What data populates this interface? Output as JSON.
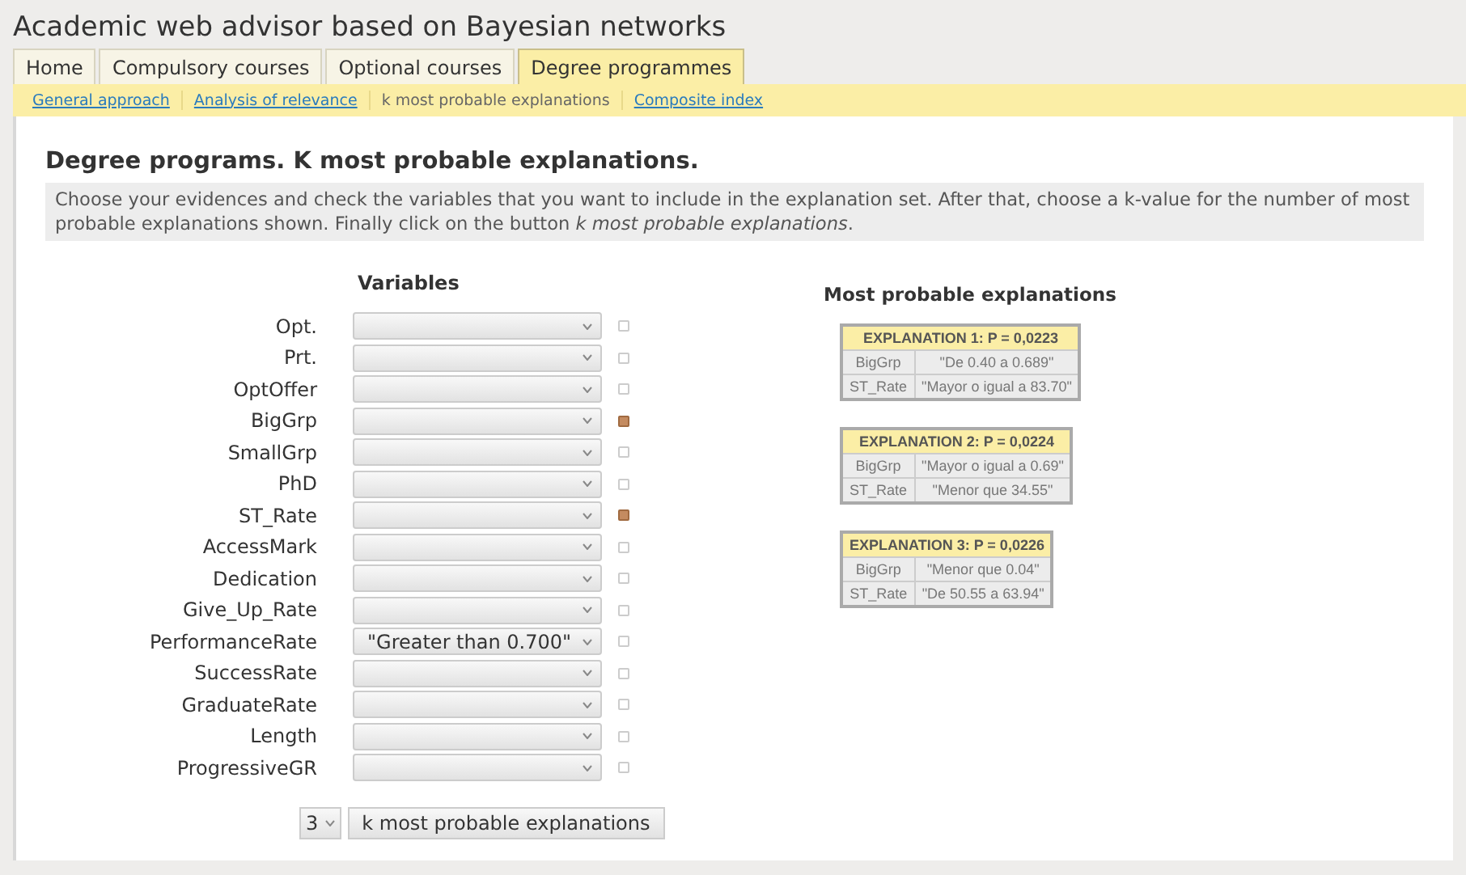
{
  "app_title": "Academic web advisor based on Bayesian networks",
  "tabs": [
    {
      "label": "Home",
      "selected": false
    },
    {
      "label": "Compulsory courses",
      "selected": false
    },
    {
      "label": "Optional courses",
      "selected": false
    },
    {
      "label": "Degree programmes",
      "selected": true
    }
  ],
  "subnav": [
    {
      "label": "General approach",
      "selected": false
    },
    {
      "label": "Analysis of relevance",
      "selected": false
    },
    {
      "label": "k most probable explanations",
      "selected": true
    },
    {
      "label": "Composite index",
      "selected": false
    }
  ],
  "heading": "Degree programs. K most probable explanations.",
  "description": "Choose your evidences and check the variables that you want to include in the explanation set. After that, choose a k-value for the number of most probable explanations shown. Finally click on the button *k most probable explanations*.",
  "variables_header": "Variables",
  "variables": [
    {
      "name": "Opt.",
      "checked": false
    },
    {
      "name": "Prt.",
      "checked": false
    },
    {
      "name": "OptOffer",
      "checked": false
    },
    {
      "name": "BigGrp",
      "checked": true
    },
    {
      "name": "SmallGrp",
      "checked": false
    },
    {
      "name": "PhD",
      "checked": false
    },
    {
      "name": "ST_Rate",
      "checked": true
    },
    {
      "name": "AccessMark",
      "checked": false
    },
    {
      "name": "Dedication",
      "checked": false
    },
    {
      "name": "Give_Up_Rate",
      "checked": false
    },
    {
      "name": "PerformanceRate",
      "value": "\"Greater than 0.700\"",
      "checked": false
    },
    {
      "name": "SuccessRate",
      "checked": false
    },
    {
      "name": "GraduateRate",
      "checked": false
    },
    {
      "name": "Length",
      "checked": false
    },
    {
      "name": "ProgressiveGR",
      "checked": false
    }
  ],
  "k_select": "3",
  "submit_button": "k most probable explanations",
  "explanations_title": "Most probable explanations",
  "explanations": [
    {
      "title": "EXPLANATION 1: P = 0,0223",
      "rows": [
        [
          "BigGrp",
          "\"De 0.40 a 0.689\""
        ],
        [
          "ST_Rate",
          "\"Mayor o igual a 83.70\""
        ]
      ]
    },
    {
      "title": "EXPLANATION 2: P = 0,0224",
      "rows": [
        [
          "BigGrp",
          "\"Mayor o igual a 0.69\""
        ],
        [
          "ST_Rate",
          "\"Menor que 34.55\""
        ]
      ]
    },
    {
      "title": "EXPLANATION 3: P = 0,0226",
      "rows": [
        [
          "BigGrp",
          "\"Menor que 0.04\""
        ],
        [
          "ST_Rate",
          "\"De 50.55 a 63.94\""
        ]
      ]
    }
  ]
}
